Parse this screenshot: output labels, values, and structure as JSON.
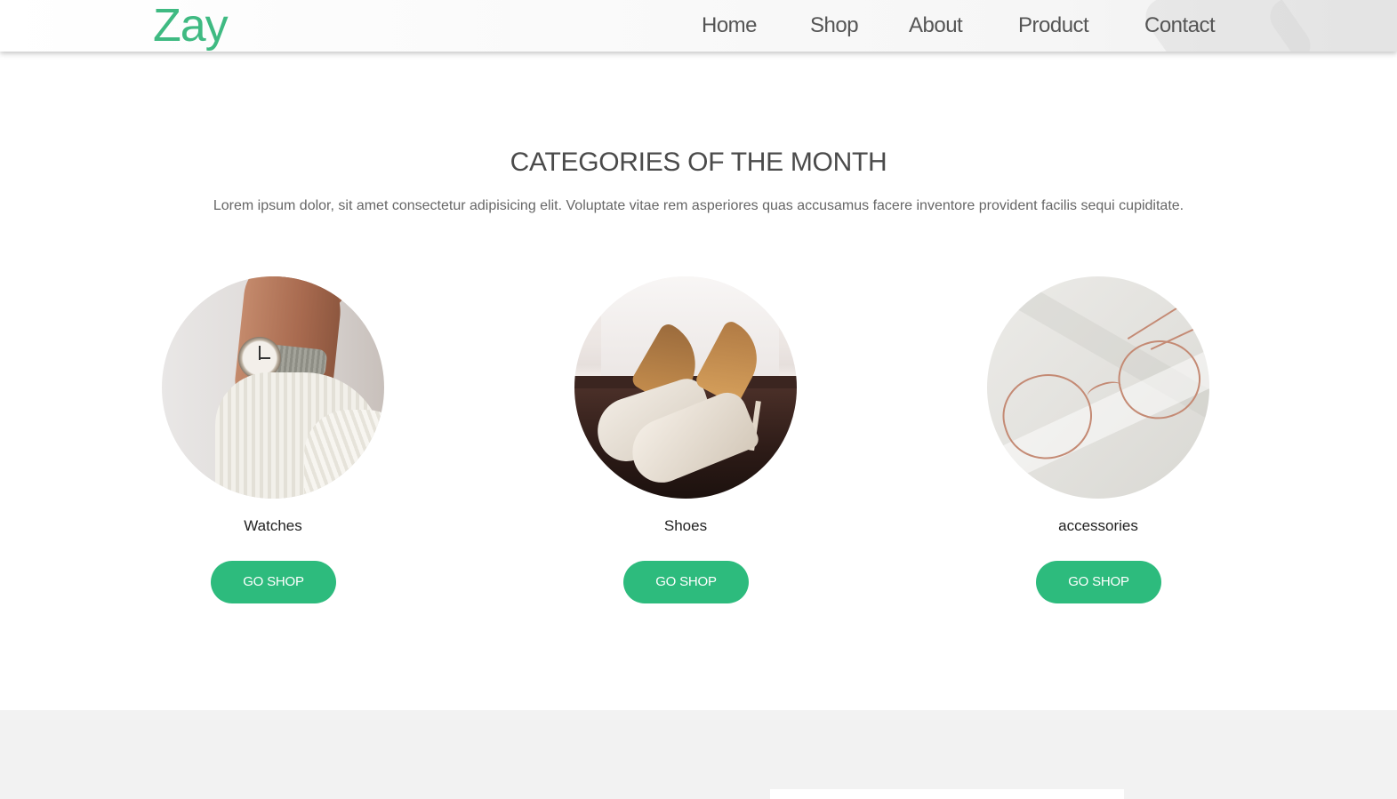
{
  "header": {
    "logo": "Zay",
    "nav": [
      "Home",
      "Shop",
      "About",
      "Product",
      "Contact"
    ]
  },
  "section": {
    "title": "CATEGORIES OF THE MONTH",
    "description": "Lorem ipsum dolor, sit amet consectetur adipisicing elit. Voluptate vitae rem asperiores quas accusamus facere inventore provident facilis sequi cupiditate."
  },
  "categories": [
    {
      "label": "Watches",
      "button": "GO SHOP"
    },
    {
      "label": "Shoes",
      "button": "GO SHOP"
    },
    {
      "label": "accessories",
      "button": "GO SHOP"
    }
  ],
  "colors": {
    "accent": "#2dbb7d",
    "logo": "#3fba82",
    "bottom_band": "#f2f2f2"
  }
}
